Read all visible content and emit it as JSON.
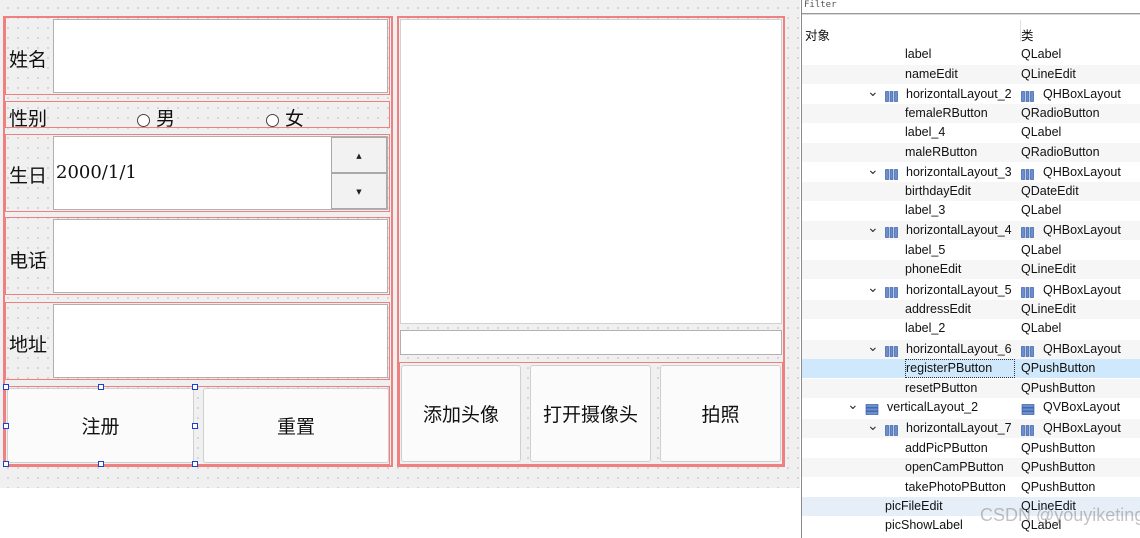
{
  "form": {
    "name_label": "姓名",
    "gender_label": "性别",
    "male_label": "男",
    "female_label": "女",
    "birthday_label": "生日",
    "birthday_value": "2000/1/1",
    "phone_label": "电话",
    "address_label": "地址",
    "register_button": "注册",
    "reset_button": "重置",
    "add_pic_button": "添加头像",
    "open_cam_button": "打开摄像头",
    "take_photo_button": "拍照",
    "spin_up": "▲",
    "spin_down": "▼"
  },
  "inspector": {
    "filter_label": "Filter",
    "col_object": "对象",
    "col_class": "类",
    "watermark": "CSDN @youyiketing",
    "rows": [
      {
        "name": "label",
        "cls": "QLabel"
      },
      {
        "name": "nameEdit",
        "cls": "QLineEdit"
      },
      {
        "name": "horizontalLayout_2",
        "cls": "QHBoxLayout"
      },
      {
        "name": "femaleRButton",
        "cls": "QRadioButton"
      },
      {
        "name": "label_4",
        "cls": "QLabel"
      },
      {
        "name": "maleRButton",
        "cls": "QRadioButton"
      },
      {
        "name": "horizontalLayout_3",
        "cls": "QHBoxLayout"
      },
      {
        "name": "birthdayEdit",
        "cls": "QDateEdit"
      },
      {
        "name": "label_3",
        "cls": "QLabel"
      },
      {
        "name": "horizontalLayout_4",
        "cls": "QHBoxLayout"
      },
      {
        "name": "label_5",
        "cls": "QLabel"
      },
      {
        "name": "phoneEdit",
        "cls": "QLineEdit"
      },
      {
        "name": "horizontalLayout_5",
        "cls": "QHBoxLayout"
      },
      {
        "name": "addressEdit",
        "cls": "QLineEdit"
      },
      {
        "name": "label_2",
        "cls": "QLabel"
      },
      {
        "name": "horizontalLayout_6",
        "cls": "QHBoxLayout"
      },
      {
        "name": "registerPButton",
        "cls": "QPushButton"
      },
      {
        "name": "resetPButton",
        "cls": "QPushButton"
      },
      {
        "name": "verticalLayout_2",
        "cls": "QVBoxLayout"
      },
      {
        "name": "horizontalLayout_7",
        "cls": "QHBoxLayout"
      },
      {
        "name": "addPicPButton",
        "cls": "QPushButton"
      },
      {
        "name": "openCamPButton",
        "cls": "QPushButton"
      },
      {
        "name": "takePhotoPButton",
        "cls": "QPushButton"
      },
      {
        "name": "picFileEdit",
        "cls": "QLineEdit"
      },
      {
        "name": "picShowLabel",
        "cls": "QLabel"
      }
    ]
  }
}
